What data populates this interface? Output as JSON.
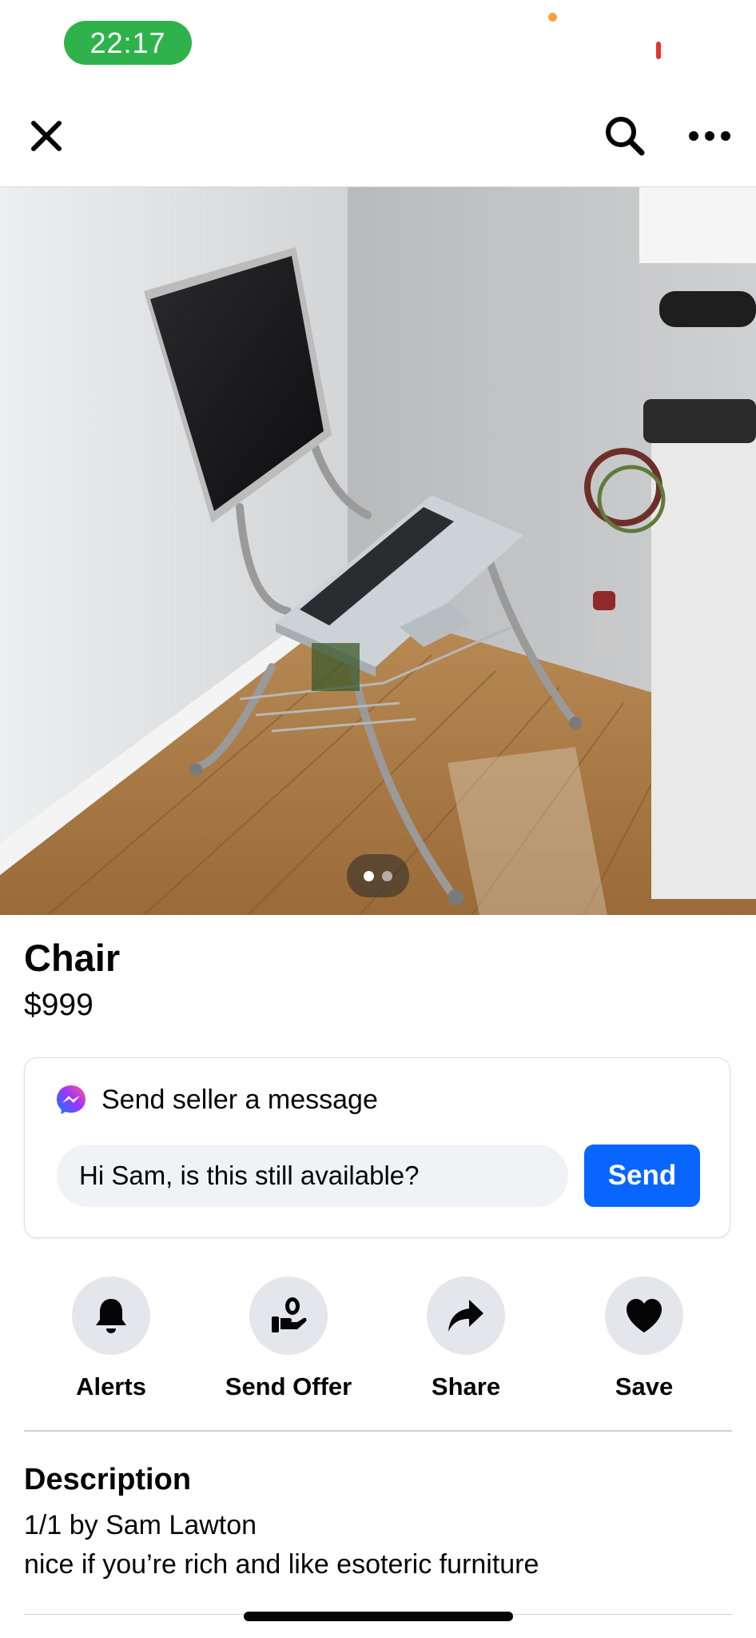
{
  "status_bar": {
    "time": "22:17"
  },
  "nav": {
    "close_icon": "close-icon",
    "search_icon": "search-icon",
    "more_icon": "more-icon"
  },
  "listing": {
    "title": "Chair",
    "price": "$999",
    "photo_page": 1,
    "photo_count": 2
  },
  "message": {
    "heading": "Send seller a message",
    "input_value": "Hi Sam, is this still available?",
    "send_label": "Send"
  },
  "actions": [
    {
      "label": "Alerts",
      "icon": "bell-icon"
    },
    {
      "label": "Send Offer",
      "icon": "offer-icon"
    },
    {
      "label": "Share",
      "icon": "share-icon"
    },
    {
      "label": "Save",
      "icon": "heart-icon"
    }
  ],
  "description": {
    "heading": "Description",
    "lines": [
      "1/1 by Sam Lawton",
      "nice if you’re rich and like esoteric furniture"
    ]
  },
  "colors": {
    "accent": "#0866ff",
    "time_pill": "#2fb24c",
    "surface": "#e4e6eb"
  }
}
